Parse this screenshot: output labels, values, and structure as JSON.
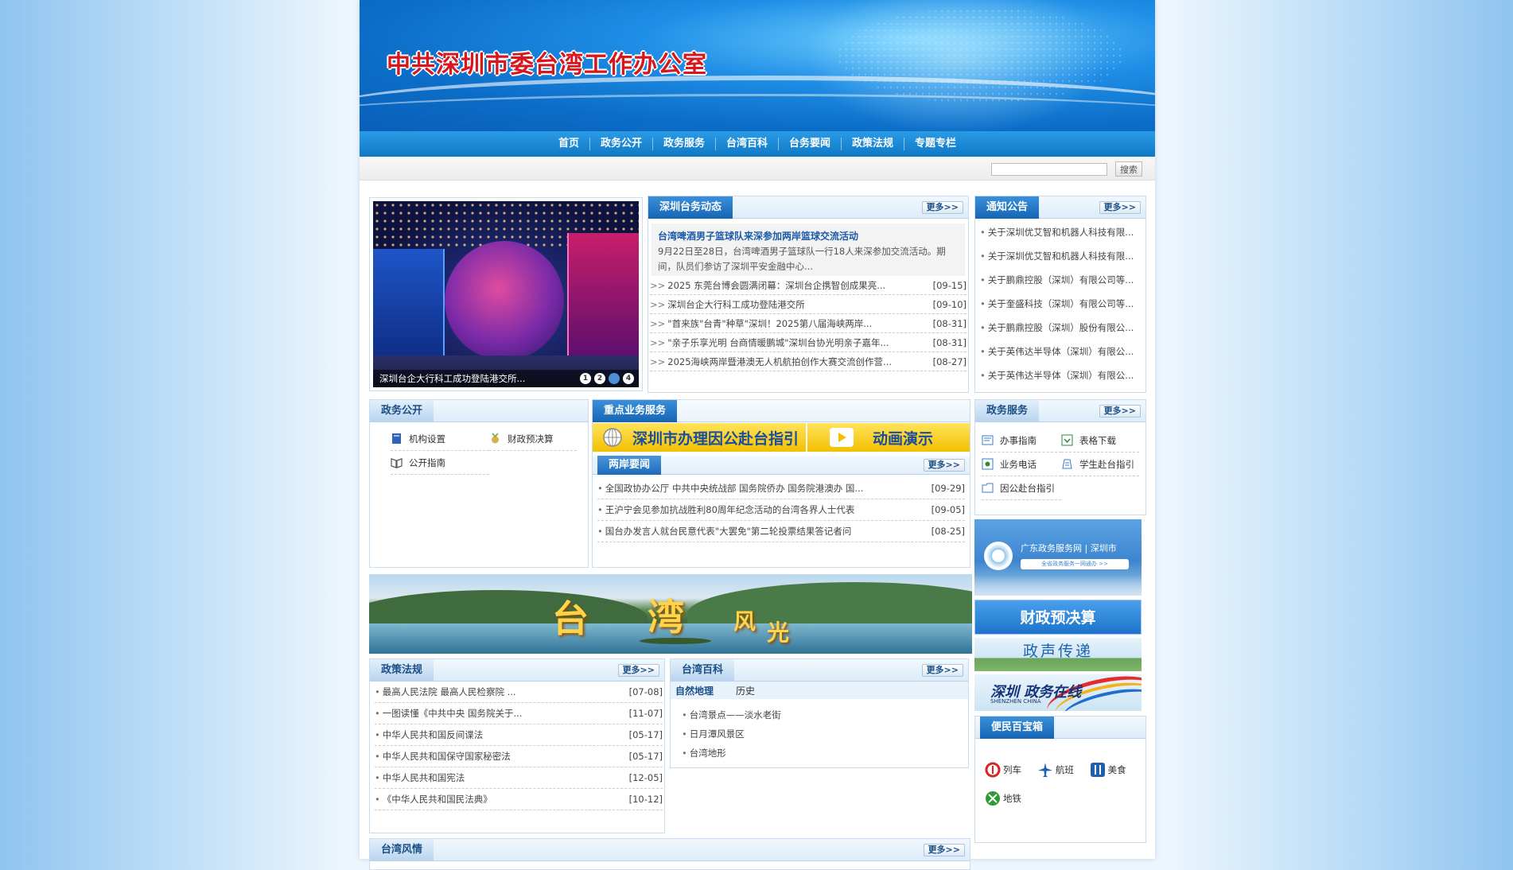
{
  "site": {
    "title": "中共深圳市委台湾工作办公室"
  },
  "nav": [
    "首页",
    "政务公开",
    "政务服务",
    "台湾百科",
    "台务要闻",
    "政策法规",
    "专题专栏"
  ],
  "search": {
    "button": "搜索",
    "value": ""
  },
  "common": {
    "more": "更多>>",
    "bullet": "•",
    "arrow": ">>"
  },
  "slideshow": {
    "caption": "深圳台企大行科工成功登陆港交所...",
    "pages": [
      "1",
      "2",
      "3",
      "4"
    ],
    "active": 2
  },
  "shenzhen_affairs": {
    "title": "深圳台务动态",
    "headline": {
      "title": "台湾啤酒男子篮球队来深参加两岸篮球交流活动",
      "desc": "9月22日至28日，台湾啤酒男子篮球队一行18人来深参加交流活动。期间，队员们参访了深圳平安金融中心..."
    },
    "items": [
      {
        "text": "2025 东莞台博会圆满闭幕：深圳台企携智创成果亮...",
        "date": "[09-15]"
      },
      {
        "text": "深圳台企大行科工成功登陆港交所",
        "date": "[09-10]"
      },
      {
        "text": "\"首来族\"台青\"种草\"深圳！2025第八届海峡两岸...",
        "date": "[08-31]"
      },
      {
        "text": "\"亲子乐享光明 台商情暖鹏城\"深圳台协光明亲子嘉年...",
        "date": "[08-31]"
      },
      {
        "text": "2025海峡两岸暨港澳无人机航拍创作大赛交流创作营...",
        "date": "[08-27]"
      }
    ]
  },
  "notices": {
    "title": "通知公告",
    "items": [
      "关于深圳优艾智和机器人科技有限...",
      "关于深圳优艾智和机器人科技有限...",
      "关于鹏鼎控股（深圳）有限公司等...",
      "关于奎盛科技（深圳）有限公司等...",
      "关于鹏鼎控股（深圳）股份有限公...",
      "关于英伟达半导体（深圳）有限公...",
      "关于英伟达半导体（深圳）有限公..."
    ]
  },
  "gov_open": {
    "title": "政务公开",
    "items": [
      {
        "label": "机构设置",
        "icon": "book-icon"
      },
      {
        "label": "财政预决算",
        "icon": "medal-icon"
      },
      {
        "label": "公开指南",
        "icon": "open-book-icon"
      }
    ]
  },
  "key_service": {
    "title": "重点业务服务",
    "btn1": "深圳市办理因公赴台指引",
    "btn2": "动画演示"
  },
  "cross_strait": {
    "title": "两岸要闻",
    "items": [
      {
        "text": "全国政协办公厅 中共中央统战部 国务院侨办 国务院港澳办 国...",
        "date": "[09-29]"
      },
      {
        "text": "王沪宁会见参加抗战胜利80周年纪念活动的台湾各界人士代表",
        "date": "[09-05]"
      },
      {
        "text": "国台办发言人就台民意代表\"大罢免\"第二轮投票结果答记者问",
        "date": "[08-25]"
      }
    ]
  },
  "gov_service": {
    "title": "政务服务",
    "items": [
      {
        "label": "办事指南",
        "icon": "guide-icon"
      },
      {
        "label": "表格下载",
        "icon": "download-icon"
      },
      {
        "label": "业务电话",
        "icon": "phone-icon"
      },
      {
        "label": "学生赴台指引",
        "icon": "student-icon"
      },
      {
        "label": "因公赴台指引",
        "icon": "folder-icon"
      }
    ]
  },
  "scenery": {
    "t1": "台",
    "t2": "湾",
    "t3": "风",
    "t4": "光"
  },
  "right_banners": {
    "b1_text": "广东政务服务网 | 深圳市",
    "b1_pill": "全省政务服务一网通办 >>",
    "b2": "财政预决算",
    "b3": "政声传递",
    "b4_title": "深圳 政务在线",
    "b4_sub": "SHENZHEN CHINA"
  },
  "policy": {
    "title": "政策法规",
    "items": [
      {
        "text": "最高人民法院   最高人民检察院   ...",
        "date": "[07-08]"
      },
      {
        "text": "一图读懂《中共中央 国务院关于...",
        "date": "[11-07]"
      },
      {
        "text": "中华人民共和国反间谍法",
        "date": "[05-17]"
      },
      {
        "text": "中华人民共和国保守国家秘密法",
        "date": "[05-17]"
      },
      {
        "text": "中华人民共和国宪法",
        "date": "[12-05]"
      },
      {
        "text": "《中华人民共和国民法典》",
        "date": "[10-12]"
      }
    ]
  },
  "taiwan_wiki": {
    "title": "台湾百科",
    "tabs": [
      "自然地理",
      "历史"
    ],
    "items": [
      "台湾景点——淡水老街",
      "日月潭风景区",
      "台湾地形"
    ]
  },
  "convenience": {
    "title": "便民百宝箱",
    "items": [
      {
        "label": "列车",
        "icon": "train-icon"
      },
      {
        "label": "航班",
        "icon": "plane-icon"
      },
      {
        "label": "美食",
        "icon": "food-icon"
      },
      {
        "label": "地铁",
        "icon": "metro-icon"
      }
    ]
  },
  "taiwan_style": {
    "title": "台湾风情"
  }
}
